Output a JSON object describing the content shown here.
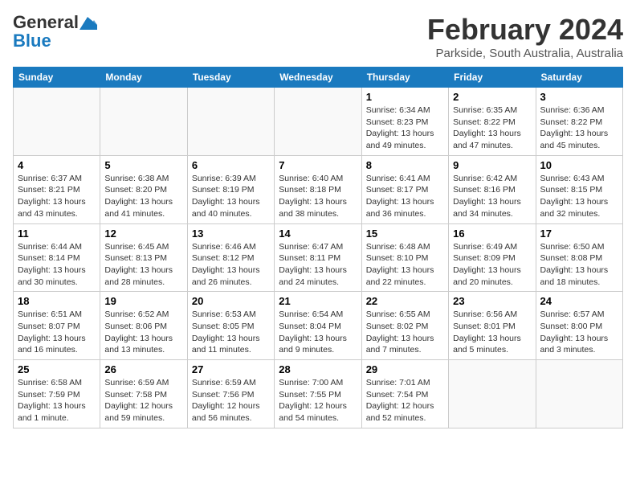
{
  "header": {
    "logo_line1": "General",
    "logo_line2": "Blue",
    "month_year": "February 2024",
    "location": "Parkside, South Australia, Australia"
  },
  "weekdays": [
    "Sunday",
    "Monday",
    "Tuesday",
    "Wednesday",
    "Thursday",
    "Friday",
    "Saturday"
  ],
  "weeks": [
    [
      {
        "day": "",
        "info": ""
      },
      {
        "day": "",
        "info": ""
      },
      {
        "day": "",
        "info": ""
      },
      {
        "day": "",
        "info": ""
      },
      {
        "day": "1",
        "info": "Sunrise: 6:34 AM\nSunset: 8:23 PM\nDaylight: 13 hours\nand 49 minutes."
      },
      {
        "day": "2",
        "info": "Sunrise: 6:35 AM\nSunset: 8:22 PM\nDaylight: 13 hours\nand 47 minutes."
      },
      {
        "day": "3",
        "info": "Sunrise: 6:36 AM\nSunset: 8:22 PM\nDaylight: 13 hours\nand 45 minutes."
      }
    ],
    [
      {
        "day": "4",
        "info": "Sunrise: 6:37 AM\nSunset: 8:21 PM\nDaylight: 13 hours\nand 43 minutes."
      },
      {
        "day": "5",
        "info": "Sunrise: 6:38 AM\nSunset: 8:20 PM\nDaylight: 13 hours\nand 41 minutes."
      },
      {
        "day": "6",
        "info": "Sunrise: 6:39 AM\nSunset: 8:19 PM\nDaylight: 13 hours\nand 40 minutes."
      },
      {
        "day": "7",
        "info": "Sunrise: 6:40 AM\nSunset: 8:18 PM\nDaylight: 13 hours\nand 38 minutes."
      },
      {
        "day": "8",
        "info": "Sunrise: 6:41 AM\nSunset: 8:17 PM\nDaylight: 13 hours\nand 36 minutes."
      },
      {
        "day": "9",
        "info": "Sunrise: 6:42 AM\nSunset: 8:16 PM\nDaylight: 13 hours\nand 34 minutes."
      },
      {
        "day": "10",
        "info": "Sunrise: 6:43 AM\nSunset: 8:15 PM\nDaylight: 13 hours\nand 32 minutes."
      }
    ],
    [
      {
        "day": "11",
        "info": "Sunrise: 6:44 AM\nSunset: 8:14 PM\nDaylight: 13 hours\nand 30 minutes."
      },
      {
        "day": "12",
        "info": "Sunrise: 6:45 AM\nSunset: 8:13 PM\nDaylight: 13 hours\nand 28 minutes."
      },
      {
        "day": "13",
        "info": "Sunrise: 6:46 AM\nSunset: 8:12 PM\nDaylight: 13 hours\nand 26 minutes."
      },
      {
        "day": "14",
        "info": "Sunrise: 6:47 AM\nSunset: 8:11 PM\nDaylight: 13 hours\nand 24 minutes."
      },
      {
        "day": "15",
        "info": "Sunrise: 6:48 AM\nSunset: 8:10 PM\nDaylight: 13 hours\nand 22 minutes."
      },
      {
        "day": "16",
        "info": "Sunrise: 6:49 AM\nSunset: 8:09 PM\nDaylight: 13 hours\nand 20 minutes."
      },
      {
        "day": "17",
        "info": "Sunrise: 6:50 AM\nSunset: 8:08 PM\nDaylight: 13 hours\nand 18 minutes."
      }
    ],
    [
      {
        "day": "18",
        "info": "Sunrise: 6:51 AM\nSunset: 8:07 PM\nDaylight: 13 hours\nand 16 minutes."
      },
      {
        "day": "19",
        "info": "Sunrise: 6:52 AM\nSunset: 8:06 PM\nDaylight: 13 hours\nand 13 minutes."
      },
      {
        "day": "20",
        "info": "Sunrise: 6:53 AM\nSunset: 8:05 PM\nDaylight: 13 hours\nand 11 minutes."
      },
      {
        "day": "21",
        "info": "Sunrise: 6:54 AM\nSunset: 8:04 PM\nDaylight: 13 hours\nand 9 minutes."
      },
      {
        "day": "22",
        "info": "Sunrise: 6:55 AM\nSunset: 8:02 PM\nDaylight: 13 hours\nand 7 minutes."
      },
      {
        "day": "23",
        "info": "Sunrise: 6:56 AM\nSunset: 8:01 PM\nDaylight: 13 hours\nand 5 minutes."
      },
      {
        "day": "24",
        "info": "Sunrise: 6:57 AM\nSunset: 8:00 PM\nDaylight: 13 hours\nand 3 minutes."
      }
    ],
    [
      {
        "day": "25",
        "info": "Sunrise: 6:58 AM\nSunset: 7:59 PM\nDaylight: 13 hours\nand 1 minute."
      },
      {
        "day": "26",
        "info": "Sunrise: 6:59 AM\nSunset: 7:58 PM\nDaylight: 12 hours\nand 59 minutes."
      },
      {
        "day": "27",
        "info": "Sunrise: 6:59 AM\nSunset: 7:56 PM\nDaylight: 12 hours\nand 56 minutes."
      },
      {
        "day": "28",
        "info": "Sunrise: 7:00 AM\nSunset: 7:55 PM\nDaylight: 12 hours\nand 54 minutes."
      },
      {
        "day": "29",
        "info": "Sunrise: 7:01 AM\nSunset: 7:54 PM\nDaylight: 12 hours\nand 52 minutes."
      },
      {
        "day": "",
        "info": ""
      },
      {
        "day": "",
        "info": ""
      }
    ]
  ]
}
